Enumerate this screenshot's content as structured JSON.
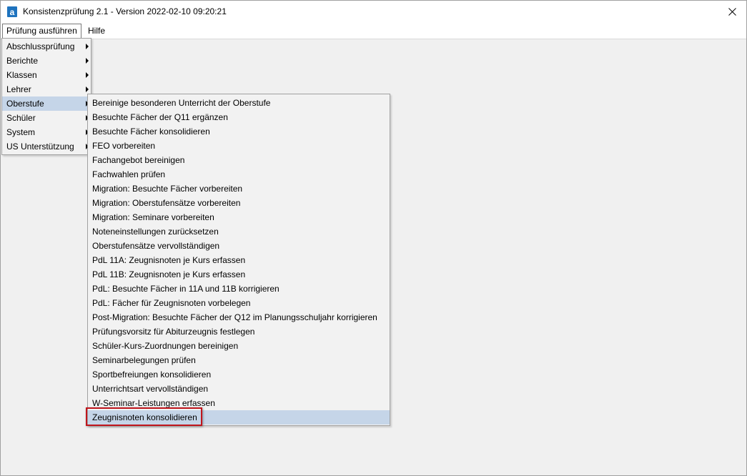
{
  "window": {
    "title": "Konsistenzprüfung 2.1 - Version 2022-02-10 09:20:21",
    "icon": "app-icon",
    "close_icon": "close-icon"
  },
  "menubar": {
    "items": [
      {
        "label": "Prüfung ausführen",
        "active": true
      },
      {
        "label": "Hilfe",
        "active": false
      }
    ]
  },
  "main_menu": {
    "items": [
      {
        "label": "Abschlussprüfung",
        "has_submenu": true
      },
      {
        "label": "Berichte",
        "has_submenu": true
      },
      {
        "label": "Klassen",
        "has_submenu": true
      },
      {
        "label": "Lehrer",
        "has_submenu": true
      },
      {
        "label": "Oberstufe",
        "has_submenu": true,
        "selected": true
      },
      {
        "label": "Schüler",
        "has_submenu": true
      },
      {
        "label": "System",
        "has_submenu": true
      },
      {
        "label": "US Unterstützung",
        "has_submenu": true
      }
    ]
  },
  "submenu": {
    "items": [
      {
        "label": "Bereinige besonderen Unterricht der Oberstufe"
      },
      {
        "label": "Besuchte Fächer der Q11 ergänzen"
      },
      {
        "label": "Besuchte Fächer konsolidieren"
      },
      {
        "label": "FEO vorbereiten"
      },
      {
        "label": "Fachangebot bereinigen"
      },
      {
        "label": "Fachwahlen prüfen"
      },
      {
        "label": "Migration: Besuchte Fächer vorbereiten"
      },
      {
        "label": "Migration: Oberstufensätze vorbereiten"
      },
      {
        "label": "Migration: Seminare vorbereiten"
      },
      {
        "label": "Noteneinstellungen zurücksetzen"
      },
      {
        "label": "Oberstufensätze vervollständigen"
      },
      {
        "label": "PdL 11A: Zeugnisnoten je Kurs erfassen"
      },
      {
        "label": "PdL 11B: Zeugnisnoten je Kurs erfassen"
      },
      {
        "label": "PdL: Besuchte Fächer in 11A und 11B korrigieren"
      },
      {
        "label": "PdL: Fächer für Zeugnisnoten vorbelegen"
      },
      {
        "label": "Post-Migration: Besuchte Fächer der Q12 im Planungsschuljahr korrigieren"
      },
      {
        "label": "Prüfungsvorsitz für Abiturzeugnis festlegen"
      },
      {
        "label": "Schüler-Kurs-Zuordnungen bereinigen"
      },
      {
        "label": "Seminarbelegungen prüfen"
      },
      {
        "label": "Sportbefreiungen konsolidieren"
      },
      {
        "label": "Unterrichtsart vervollständigen"
      },
      {
        "label": "W-Seminar-Leistungen erfassen"
      },
      {
        "label": "Zeugnisnoten konsolidieren",
        "selected": true
      }
    ]
  },
  "colors": {
    "menu_selected": "#c5d5e8",
    "highlight_border": "#c0151c",
    "client_bg": "#f0f0f0",
    "app_icon": "#1e73be"
  }
}
